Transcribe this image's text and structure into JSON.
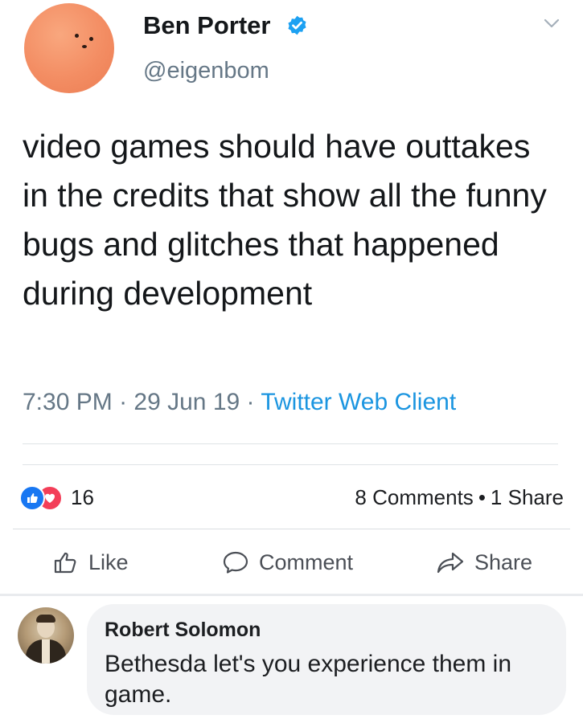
{
  "tweet": {
    "author_name": "Ben Porter",
    "author_handle": "@eigenbom",
    "verified": true,
    "text": "video games should have outtakes in the credits that show all the funny bugs and glitches that happened during development",
    "time": "7:30 PM",
    "separator": " · ",
    "date": "29 Jun 19",
    "client": "Twitter Web Client",
    "icons": {
      "verified": "verified-badge-icon",
      "menu": "chevron-down-icon"
    }
  },
  "post_stats": {
    "reaction_count": "16",
    "comments": "8 Comments",
    "dot": "•",
    "shares": "1 Share",
    "reaction_icons": [
      "like-reaction-icon",
      "love-reaction-icon"
    ]
  },
  "actions": {
    "like_label": "Like",
    "comment_label": "Comment",
    "share_label": "Share"
  },
  "comment": {
    "author": "Robert Solomon",
    "text": "Bethesda let's you experience them in game."
  },
  "colors": {
    "link_blue": "#1b95e0",
    "verified_blue": "#1da1f2",
    "like_blue": "#1877f2",
    "love_red": "#f33e58",
    "muted_text": "#657786",
    "comment_bg": "#f2f3f5"
  }
}
